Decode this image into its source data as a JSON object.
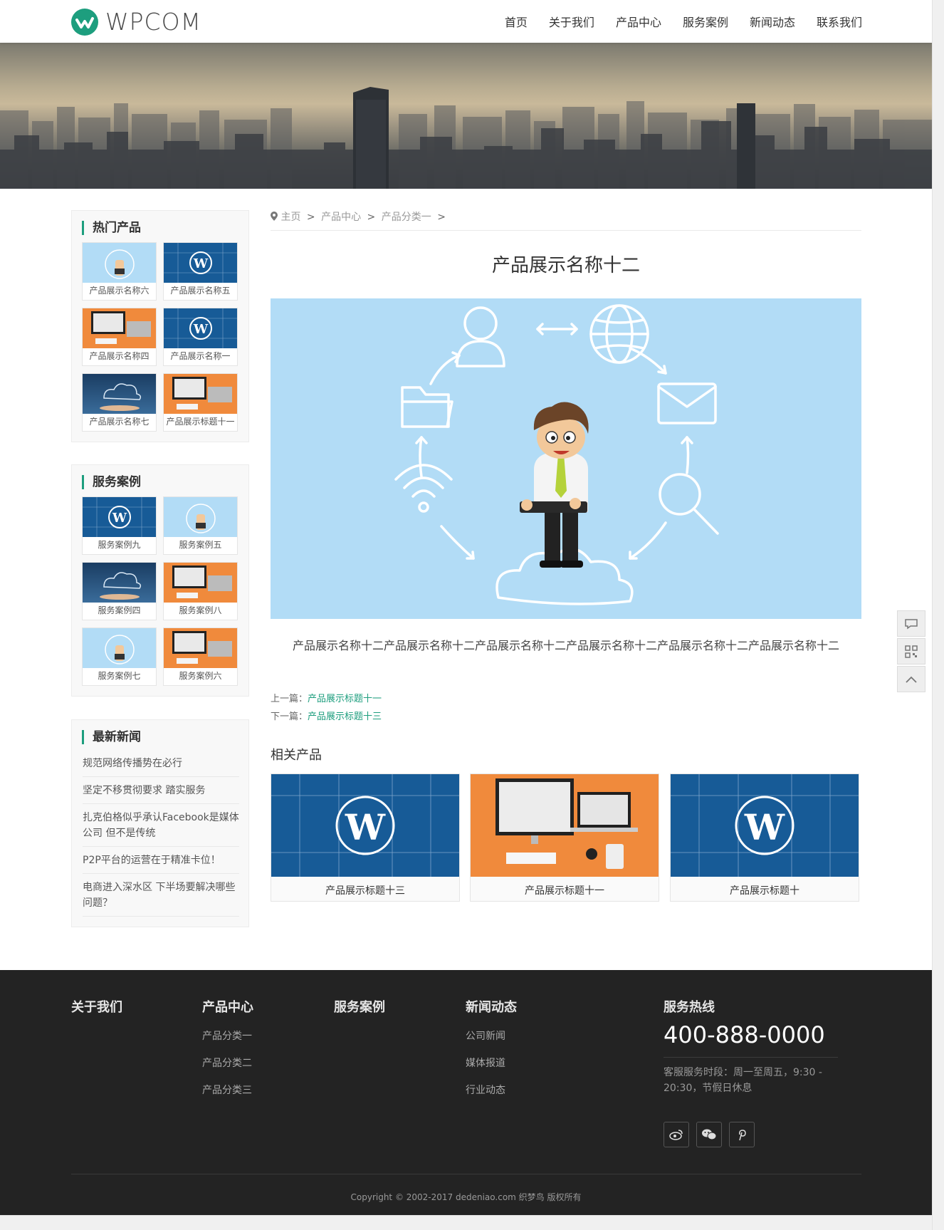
{
  "logo": {
    "text": "WPCOM"
  },
  "nav": [
    "首页",
    "关于我们",
    "产品中心",
    "服务案例",
    "新闻动态",
    "联系我们"
  ],
  "hot_products": {
    "title": "热门产品",
    "items": [
      "产品展示名称六",
      "产品展示名称五",
      "产品展示名称四",
      "产品展示名称一",
      "产品展示名称七",
      "产品展示标题十一"
    ]
  },
  "cases": {
    "title": "服务案例",
    "items": [
      "服务案例九",
      "服务案例五",
      "服务案例四",
      "服务案例八",
      "服务案例七",
      "服务案例六"
    ]
  },
  "latest_news": {
    "title": "最新新闻",
    "items": [
      "规范网络传播势在必行",
      "坚定不移贯彻要求 踏实服务",
      "扎克伯格似乎承认Facebook是媒体公司 但不是传统",
      "P2P平台的运营在于精准卡位！",
      "电商进入深水区 下半场要解决哪些问题？"
    ]
  },
  "breadcrumb": {
    "home": "主页",
    "level1": "产品中心",
    "level2": "产品分类一",
    "sep": ">"
  },
  "article": {
    "title": "产品展示名称十二",
    "description": "产品展示名称十二产品展示名称十二产品展示名称十二产品展示名称十二产品展示名称十二产品展示名称十二",
    "prev_label": "上一篇：",
    "prev_link": "产品展示标题十一",
    "next_label": "下一篇：",
    "next_link": "产品展示标题十三"
  },
  "related": {
    "title": "相关产品",
    "items": [
      "产品展示标题十三",
      "产品展示标题十一",
      "产品展示标题十"
    ]
  },
  "footer": {
    "about": "关于我们",
    "products": {
      "title": "产品中心",
      "links": [
        "产品分类一",
        "产品分类二",
        "产品分类三"
      ]
    },
    "cases": "服务案例",
    "news": {
      "title": "新闻动态",
      "links": [
        "公司新闻",
        "媒体报道",
        "行业动态"
      ]
    },
    "hotline": {
      "title": "服务热线",
      "number": "400-888-0000",
      "hours": "客服服务时段：周一至周五，9:30 - 20:30，节假日休息"
    },
    "copyright": "Copyright © 2002-2017 dedeniao.com 织梦鸟 版权所有"
  },
  "colors": {
    "accent": "#1d9e7e",
    "footer_bg": "#232323",
    "wp_blue": "#175b97",
    "orange": "#f08a3c",
    "sky": "#b2dcf6"
  }
}
